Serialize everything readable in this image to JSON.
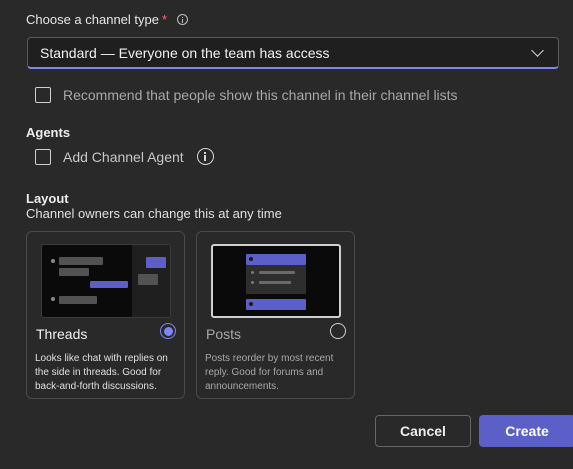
{
  "channel_type": {
    "label": "Choose a channel type",
    "required_mark": "*",
    "selected": "Standard — Everyone on the team has access"
  },
  "recommend": {
    "label": "Recommend that people show this channel in their channel lists",
    "checked": false
  },
  "agents": {
    "title": "Agents",
    "add_label": "Add Channel Agent",
    "checked": false
  },
  "layout": {
    "title": "Layout",
    "subtitle": "Channel owners can change this at any time",
    "options": [
      {
        "title": "Threads",
        "description": "Looks like chat with replies on the side in threads. Good for back-and-forth discussions.",
        "selected": true
      },
      {
        "title": "Posts",
        "description": "Posts reorder by most recent reply. Good for forums and announcements.",
        "selected": false
      }
    ]
  },
  "buttons": {
    "cancel": "Cancel",
    "create": "Create"
  },
  "colors": {
    "accent": "#5b5fc7",
    "accent_light": "#7f85f5",
    "required": "#f1707b"
  }
}
